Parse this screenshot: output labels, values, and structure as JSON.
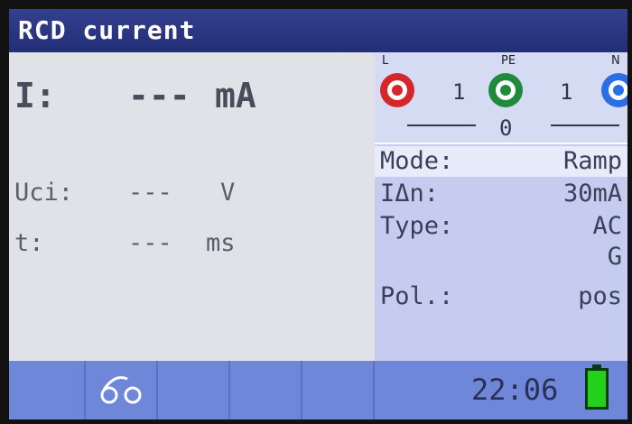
{
  "title": "RCD current",
  "result": {
    "label": "I:",
    "value": "---",
    "unit": "mA"
  },
  "subresults": [
    {
      "label": "Uci:",
      "value": "---",
      "unit": "V"
    },
    {
      "label": "t:",
      "value": "---",
      "unit": "ms"
    }
  ],
  "terminals": {
    "l_label": "L",
    "pe_label": "PE",
    "n_label": "N",
    "count_l_pe": "1",
    "count_pe_n": "1",
    "count_pe": "0",
    "colors": {
      "l": "#d7262b",
      "pe": "#1f8a3a",
      "n": "#2c6ee6"
    }
  },
  "settings": [
    {
      "label": "Mode:",
      "value": "Ramp",
      "selected": true
    },
    {
      "label": "IΔn:",
      "value": "30mA"
    },
    {
      "label": "Type:",
      "value": "AC"
    },
    {
      "label": "",
      "value": "G"
    },
    {
      "label": "Pol.:",
      "value": "pos"
    }
  ],
  "status": {
    "time": "22:06",
    "battery_color": "#22d21a"
  },
  "icons": {
    "probe": "probe-icon"
  }
}
